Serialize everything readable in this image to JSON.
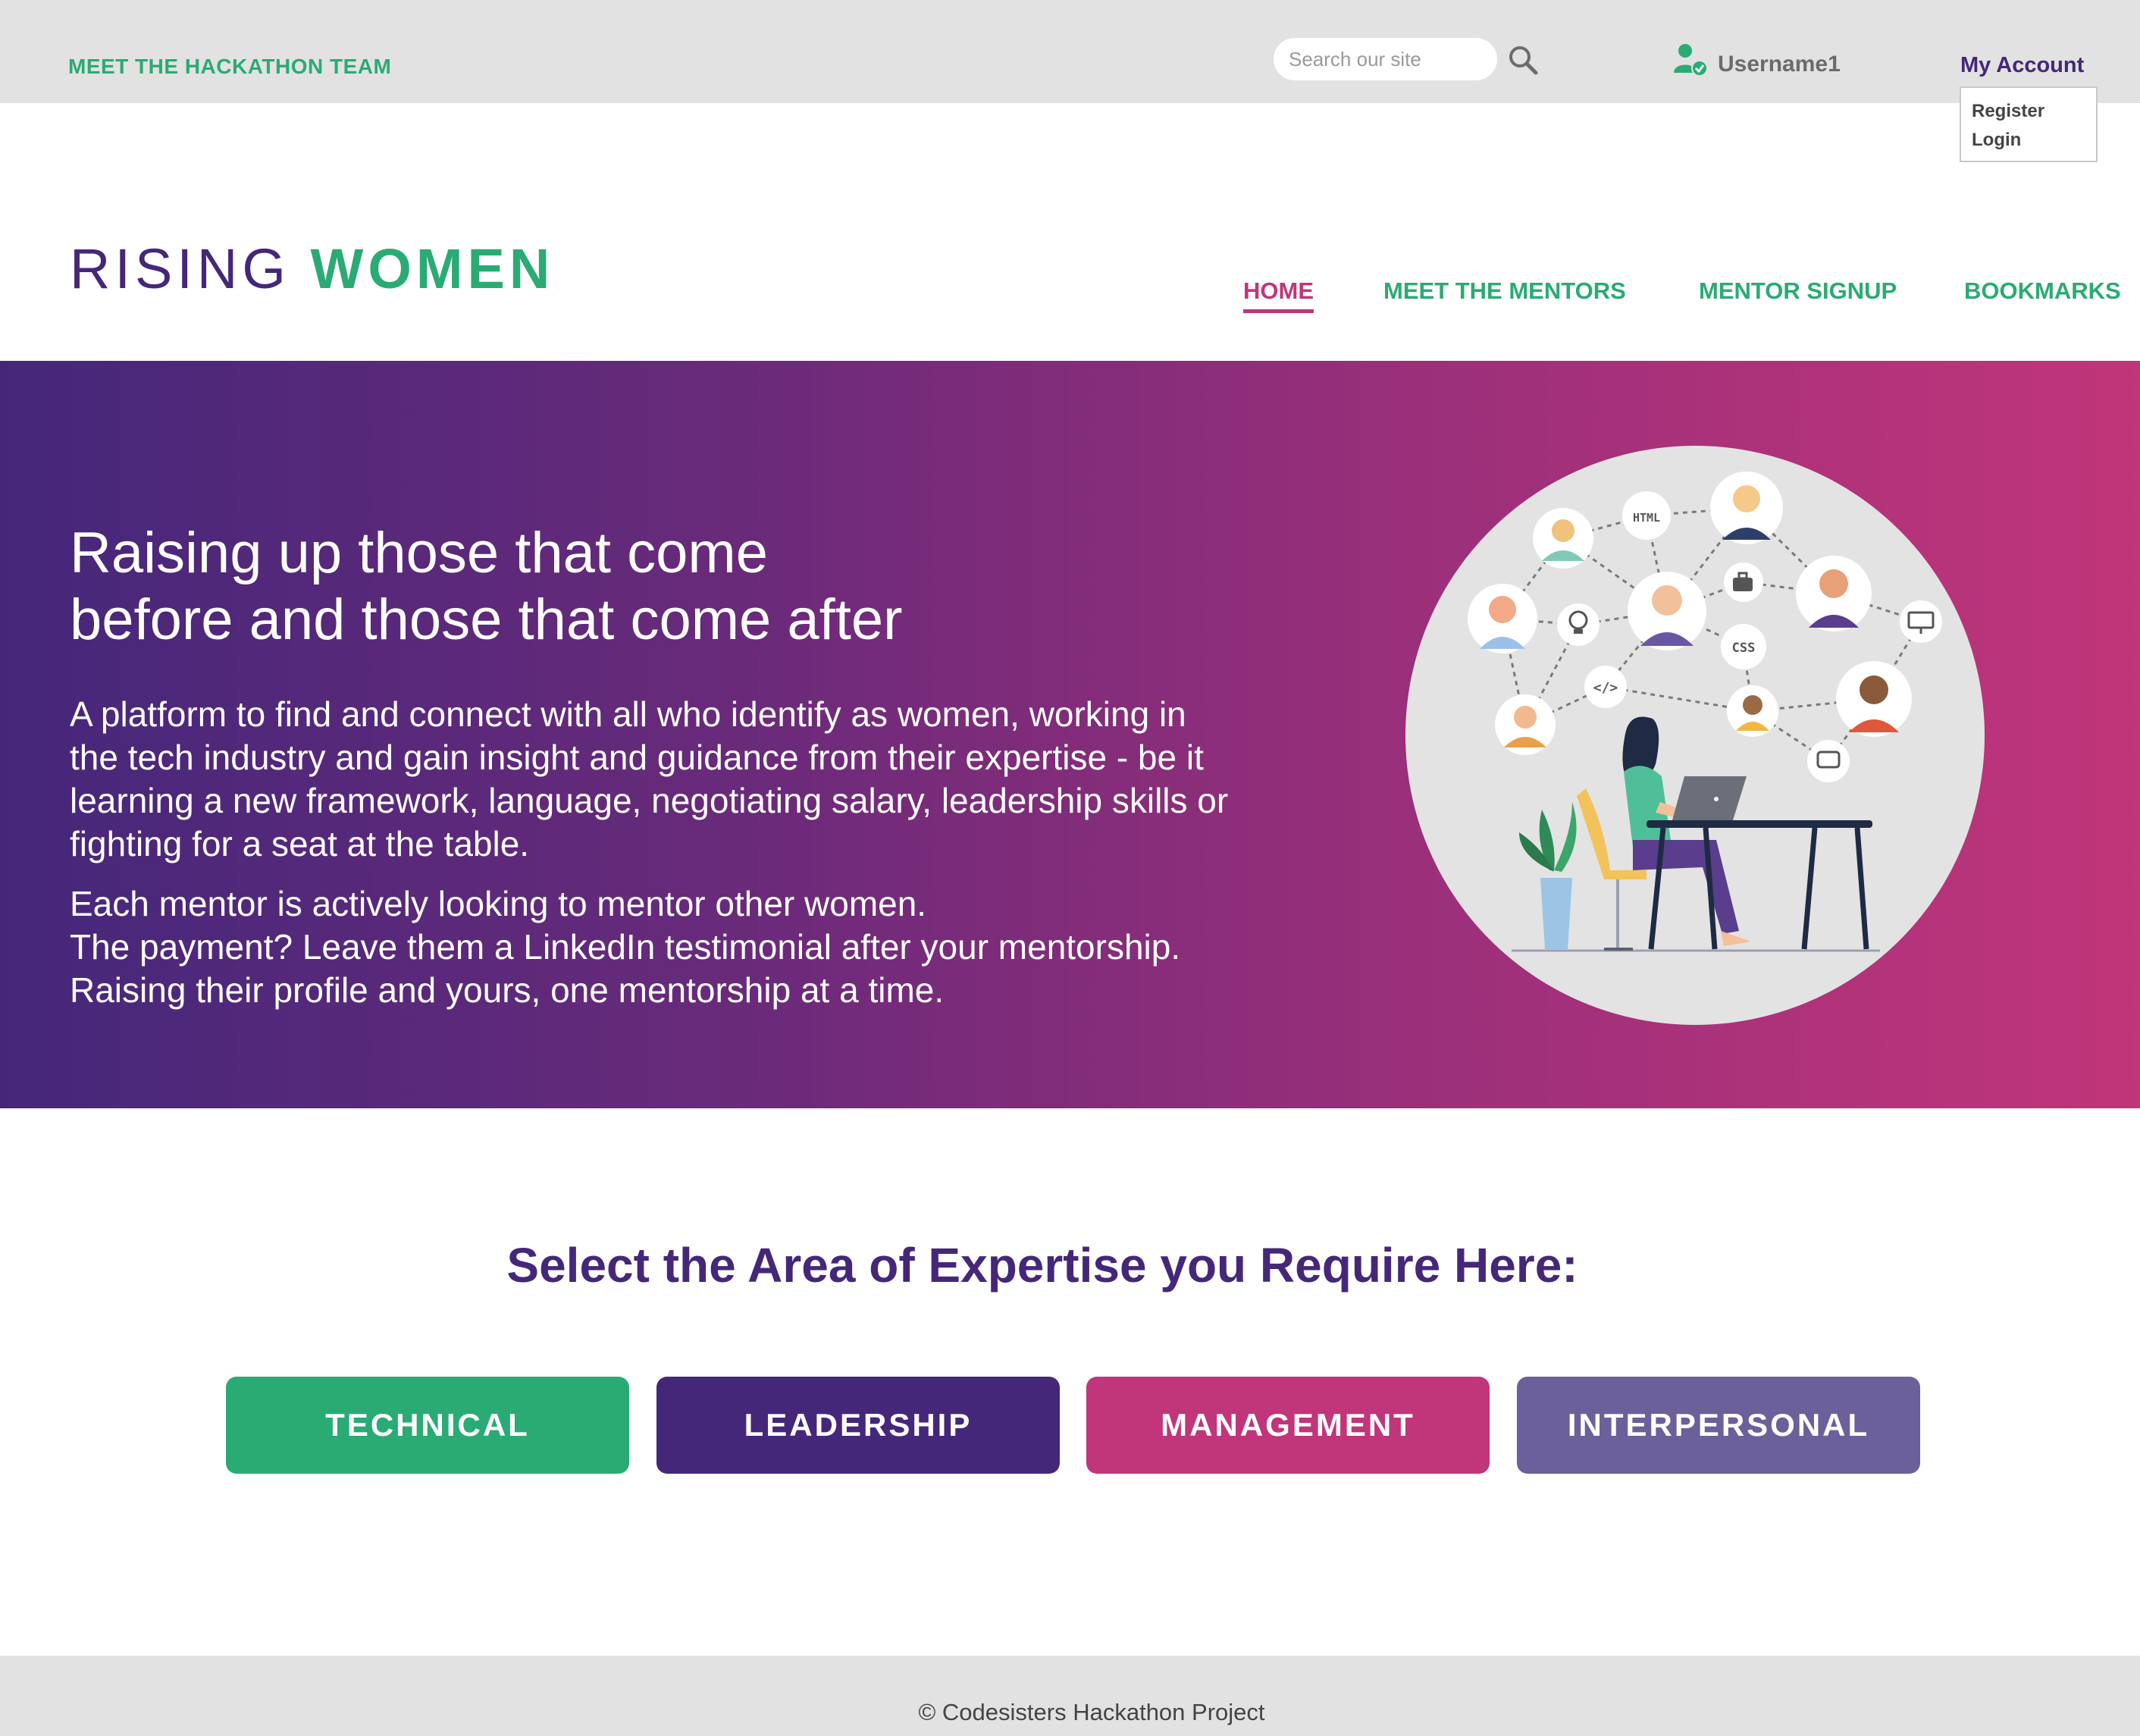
{
  "topbar": {
    "team_link": "MEET THE HACKATHON TEAM",
    "search_placeholder": "Search our site",
    "username": "Username1",
    "account_label": "My Account",
    "account_menu": [
      "Register",
      "Login"
    ]
  },
  "header": {
    "logo_part1": "RISING",
    "logo_part2": "WOMEN",
    "nav": [
      "HOME",
      "MEET THE MENTORS",
      "MENTOR SIGNUP",
      "BOOKMARKS"
    ],
    "active_nav": "HOME"
  },
  "hero": {
    "title_line1": "Raising up those that come",
    "title_line2": "before and those that come after",
    "paragraph1_lines": [
      "A platform to find and connect with all who identify as women, working in",
      "the tech industry and gain insight and guidance from their expertise - be it",
      "learning a new framework, language, negotiating salary, leadership skills or",
      "fighting for a seat at the table."
    ],
    "paragraph2_lines": [
      "Each mentor is actively looking to mentor other women.",
      "The payment? Leave them a LinkedIn testimonial after your mentorship.",
      "Raising their profile and yours, one mentorship at a time."
    ],
    "illustration_badges": [
      "HTML",
      "CSS",
      "</>"
    ]
  },
  "expertise": {
    "title": "Select the Area of Expertise you Require Here:",
    "categories": [
      {
        "label": "TECHNICAL",
        "color": "#2aab74"
      },
      {
        "label": "LEADERSHIP",
        "color": "#45277a"
      },
      {
        "label": "MANAGEMENT",
        "color": "#c1357a"
      },
      {
        "label": "INTERPERSONAL",
        "color": "#6c609a"
      }
    ]
  },
  "footer": {
    "text": "© Codesisters Hackathon Project"
  },
  "colors": {
    "green": "#2aab74",
    "purple": "#45277a",
    "magenta": "#c1357a",
    "lavender": "#6c609a",
    "gray_bar": "#e2e2e2"
  }
}
